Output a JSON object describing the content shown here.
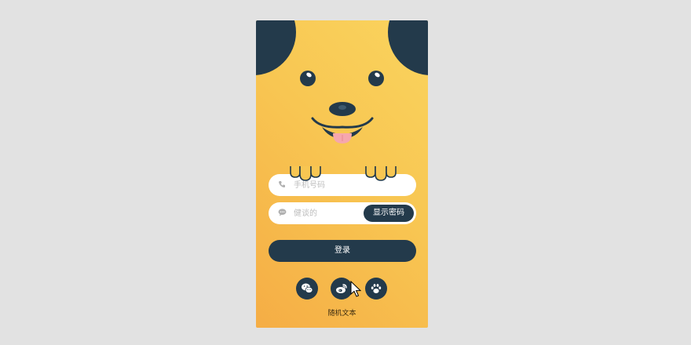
{
  "colors": {
    "page_background": "#e2e2e2",
    "card_gradient": [
      "#fad45e",
      "#f5ad45"
    ],
    "dark_navy": "#233a4b",
    "tongue": "#f6a7ad"
  },
  "form": {
    "phone_placeholder": "手机号码",
    "phone_icon": "phone-icon",
    "password_placeholder": "健谈的",
    "password_icon": "chat-bubble-icon",
    "show_password_label": "显示密码",
    "login_label": "登录"
  },
  "social": [
    {
      "name": "wechat",
      "icon": "wechat-icon"
    },
    {
      "name": "weibo",
      "icon": "weibo-icon"
    },
    {
      "name": "paw",
      "icon": "paw-icon"
    }
  ],
  "footer": {
    "text": "随机文本"
  }
}
